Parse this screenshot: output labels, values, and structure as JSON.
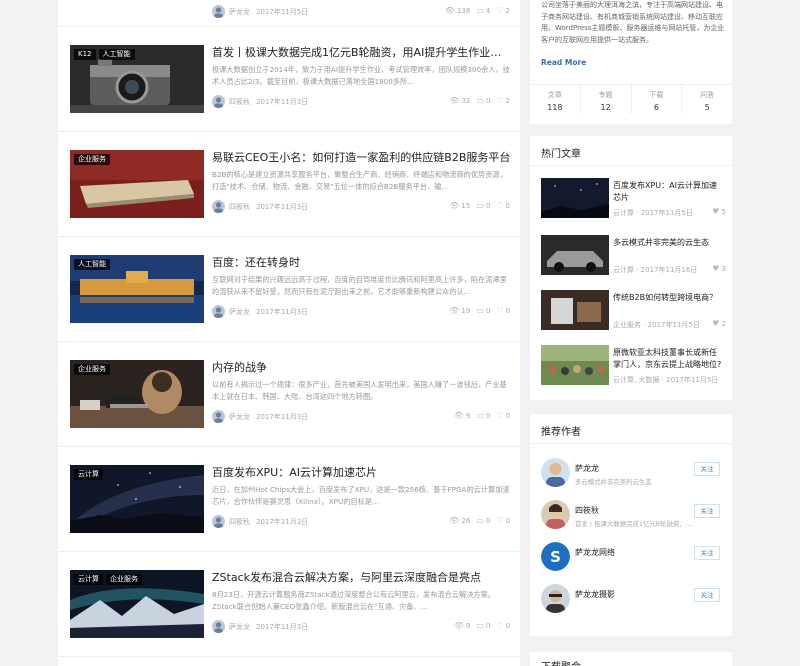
{
  "top_article": {
    "author": "萨龙龙",
    "date": "2017年11月5日",
    "views": "138",
    "comments": "4",
    "likes": "2"
  },
  "articles": [
    {
      "tags": [
        "K12",
        "人工智能"
      ],
      "title": "首发丨极课大数据完成1亿元B轮融资，用AI提升学生作业、考试...",
      "summary": "极课大数据创立于2014年，致力于用AI提升学生作业、考试管理效率，团队规模300余人，技术人员占比2/3。截至目前，极课大数据已落地全国1800多所...",
      "author": "四筱秋",
      "date": "2017年11月3日",
      "views": "32",
      "comments": "0",
      "likes": "2"
    },
    {
      "tags": [
        "企业服务"
      ],
      "title": "易联云CEO王小名：如何打造一家盈利的供应链B2B服务平台",
      "summary": "B2B的核心是建立资源共享服务平台，聚整合生产商、经销商、终端店和物流商的优势资源，打造\"技术、仓储、物流、金融、交易\"五位一体的综合B2B服务平台，输...",
      "author": "四筱秋",
      "date": "2017年11月3日",
      "views": "15",
      "comments": "0",
      "likes": "0"
    },
    {
      "tags": [
        "人工智能"
      ],
      "title": "百度：还在转身时",
      "summary": "互联网对于结果的兴趣远远高于过程，百度的自驾堆度也比腾讯和阿里高上许多，陷在泥潭里的混获从来不留好受，然而只有在泥泞跑出来之前，它才能够重新构建公众的认...",
      "author": "萨龙龙",
      "date": "2017年11月3日",
      "views": "19",
      "comments": "0",
      "likes": "0"
    },
    {
      "tags": [
        "企业服务"
      ],
      "title": "内存的战争",
      "summary": "以前有人揭示过一个规律：很多产业，首先被美国人发明出来，美国人赚了一波钱后，产业基本上就在日本、韩国、大陆、台湾这四个地方转圈。",
      "author": "萨龙龙",
      "date": "2017年11月3日",
      "views": "9",
      "comments": "0",
      "likes": "0"
    },
    {
      "tags": [
        "云计算"
      ],
      "title": "百度发布XPU：AI云计算加速芯片",
      "summary": "近日，在加州Hot Chips大会上，百度发布了XPU，这是一款256核、基于FPGA的云计算加速芯片，合作伙伴是赛灵思（Xilinx）。XPU的目标是...",
      "author": "四筱秋",
      "date": "2017年11月3日",
      "views": "26",
      "comments": "0",
      "likes": "0"
    },
    {
      "tags": [
        "云计算",
        "企业服务"
      ],
      "title": "ZStack发布混合云解决方案，与阿里云深度融合是亮点",
      "summary": "8月23日，开源云计算服务商ZStack通过深度整合公有云阿里云，发布混合云解决方案。ZStack联合创始人兼CEO张鑫介绍，新版混合云在\"互通、灾备、...",
      "author": "萨龙龙",
      "date": "2017年11月3日",
      "views": "9",
      "comments": "0",
      "likes": "0"
    }
  ],
  "about": {
    "text_lines": [
      "公司坐落于美丽的大理洱海之滨，专注于高端网站建设、电",
      "子商务网站建设、有机商城营销系统网站建设、移动互联应",
      "用、WordPress主题模板、服务器运维与网站托管，为企业",
      "客户的互联网应用提供一站式服务。"
    ],
    "read_more": "Read More",
    "counters": [
      {
        "label": "文章",
        "value": "118"
      },
      {
        "label": "专题",
        "value": "12"
      },
      {
        "label": "下载",
        "value": "6"
      },
      {
        "label": "问答",
        "value": "5"
      }
    ]
  },
  "hot": {
    "title": "热门文章",
    "items": [
      {
        "title": "百度发布XPU：AI云计算加速芯片",
        "meta": "云计算 · 2017年11月5日",
        "likes": "5"
      },
      {
        "title": "多云模式并非完美的云生态",
        "meta": "云计算 · 2017年11月16日",
        "likes": "3"
      },
      {
        "title": "传统B2B如何转型跨境电商？",
        "meta": "企业服务 · 2017年11月5日",
        "likes": "2"
      },
      {
        "title": "原微软亚太科技董事长或新任掌门人，京东云提上战略地位?",
        "meta": "云计算, 大数据 · 2017年11月5日",
        "likes": ""
      }
    ]
  },
  "recommend": {
    "title": "推荐作者",
    "follow_label": "关注",
    "authors": [
      {
        "name": "萨龙龙",
        "desc": "多云模式并非完美的云生态"
      },
      {
        "name": "四筱秋",
        "desc": "首发丨极课大数据完成1亿元B轮融资，用..."
      },
      {
        "name": "萨龙龙网络",
        "desc": ""
      },
      {
        "name": "萨龙龙摄影",
        "desc": ""
      }
    ]
  },
  "downloads": {
    "title": "下载聚合"
  }
}
